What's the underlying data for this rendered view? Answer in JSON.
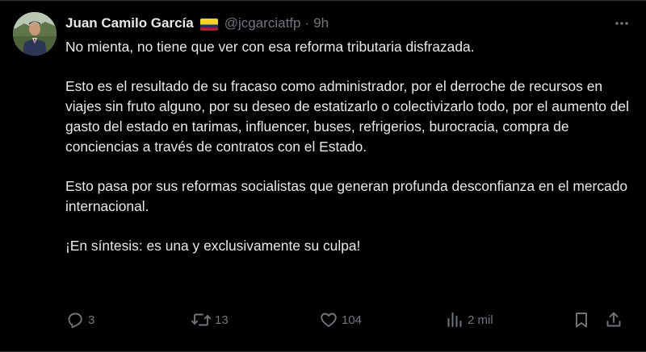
{
  "author": {
    "name": "Juan Camilo García",
    "handle": "@jcgarciatfp",
    "separator": "·",
    "time": "9h",
    "flag_icon": "colombia-flag-icon"
  },
  "tweet": {
    "paragraphs": [
      "No mienta, no tiene que ver con esa reforma tributaria disfrazada.",
      "Esto es el resultado de su fracaso como administrador, por el derroche de recursos en viajes sin fruto alguno, por su deseo de estatizarlo o colectivizarlo todo, por el aumento del gasto del estado en tarimas, influencer, buses, refrigerios, burocracia, compra de conciencias a través de contratos con el Estado.",
      "Esto pasa por sus reformas socialistas que generan profunda desconfianza en el mercado internacional.",
      "¡En síntesis: es una y exclusivamente su culpa!"
    ]
  },
  "actions": {
    "replies": "3",
    "reposts": "13",
    "likes": "104",
    "views": "2 mil"
  },
  "colors": {
    "background": "#000000",
    "text": "#e7e9ea",
    "secondary": "#71767b",
    "divider": "#2f3336"
  }
}
